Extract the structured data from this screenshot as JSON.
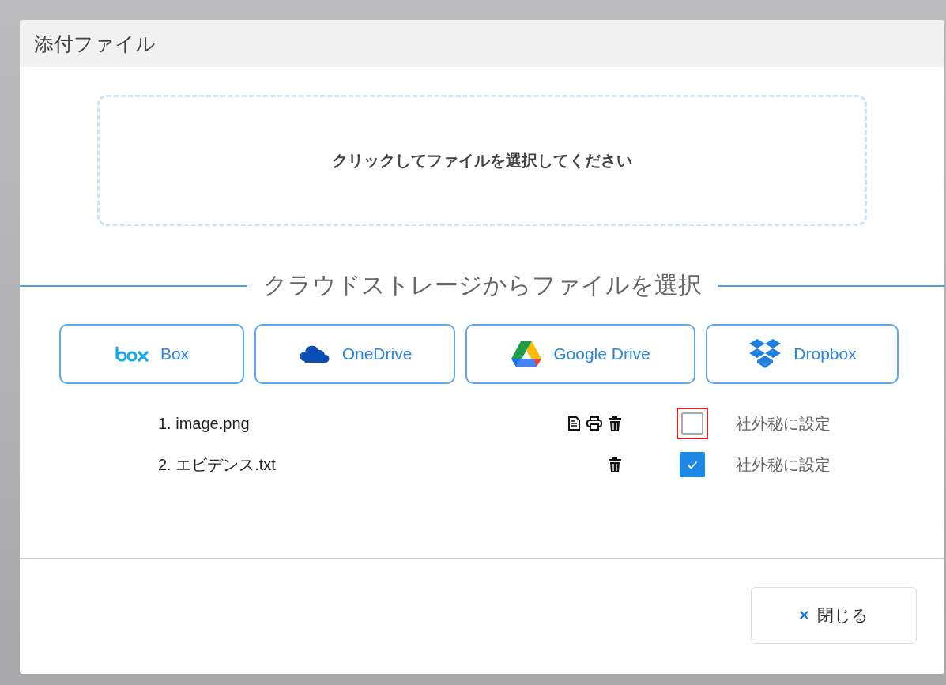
{
  "dialog": {
    "title": "添付ファイル"
  },
  "dropzone": {
    "text": "クリックしてファイルを選択してください"
  },
  "cloud_section": {
    "title": "クラウドストレージからファイルを選択"
  },
  "cloud_buttons": [
    {
      "kind": "box",
      "label": "Box"
    },
    {
      "kind": "onedrive",
      "label": "OneDrive"
    },
    {
      "kind": "gdrive",
      "label": "Google Drive"
    },
    {
      "kind": "dropbox",
      "label": "Dropbox"
    }
  ],
  "files": [
    {
      "number": "1.",
      "name": "image.png",
      "actions": [
        {
          "kind": "preview"
        },
        {
          "kind": "print"
        },
        {
          "kind": "delete"
        }
      ],
      "confidential": false,
      "confidential_label": "社外秘に設定",
      "highlighted": true
    },
    {
      "number": "2.",
      "name": "エビデンス.txt",
      "actions": [
        {
          "kind": "delete"
        }
      ],
      "confidential": true,
      "confidential_label": "社外秘に設定",
      "highlighted": false
    }
  ],
  "footer": {
    "close_icon": "×",
    "close_label": "閉じる"
  }
}
